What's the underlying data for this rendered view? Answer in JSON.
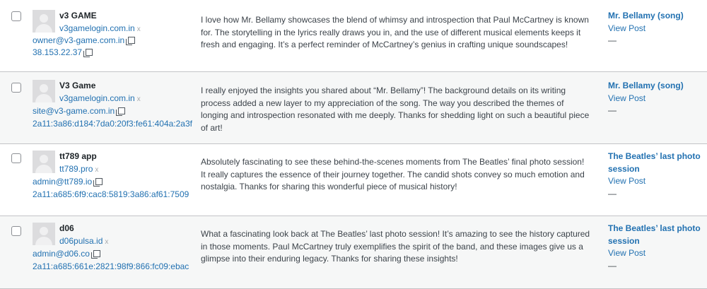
{
  "comments": [
    {
      "author_name": "v3 GAME",
      "author_url": "v3gamelogin.com.in",
      "author_url_remove": "x",
      "author_email": "owner@v3-game.com.in",
      "author_ip": "38.153.22.37",
      "comment": "I love how Mr. Bellamy showcases the blend of whimsy and introspection that Paul McCartney is known for. The storytelling in the lyrics really draws you in, and the use of different musical elements keeps it fresh and engaging. It’s a perfect reminder of McCartney’s genius in crafting unique soundscapes!",
      "response_title": "Mr. Bellamy (song)",
      "view_post": "View Post",
      "dash": "—"
    },
    {
      "author_name": "V3 Game",
      "author_url": "v3gamelogin.com.in",
      "author_url_remove": "x",
      "author_email": "site@v3-game.com.in",
      "author_ip": "2a11:3a86:d184:7da0:20f3:fe61:404a:2a3f",
      "comment": "I really enjoyed the insights you shared about “Mr. Bellamy”! The background details on its writing process added a new layer to my appreciation of the song. The way you described the themes of longing and introspection resonated with me deeply. Thanks for shedding light on such a beautiful piece of art!",
      "response_title": "Mr. Bellamy (song)",
      "view_post": "View Post",
      "dash": "—"
    },
    {
      "author_name": "tt789 app",
      "author_url": "tt789.pro",
      "author_url_remove": "x",
      "author_email": "admin@tt789.io",
      "author_ip": "2a11:a685:6f9:cac8:5819:3a86:af61:7509",
      "comment": "Absolutely fascinating to see these behind-the-scenes moments from The Beatles’ final photo session! It really captures the essence of their journey together. The candid shots convey so much emotion and nostalgia. Thanks for sharing this wonderful piece of musical history!",
      "response_title": "The Beatles’ last photo session",
      "view_post": "View Post",
      "dash": "—"
    },
    {
      "author_name": "d06",
      "author_url": "d06pulsa.id",
      "author_url_remove": "x",
      "author_email": "admin@d06.co",
      "author_ip": "2a11:a685:661e:2821:98f9:866:fc09:ebac",
      "comment": "What a fascinating look back at The Beatles’ last photo session! It’s amazing to see the history captured in those moments. Paul McCartney truly exemplifies the spirit of the band, and these images give us a glimpse into their enduring legacy. Thanks for sharing these insights!",
      "response_title": "The Beatles’ last photo session",
      "view_post": "View Post",
      "dash": "—"
    }
  ]
}
